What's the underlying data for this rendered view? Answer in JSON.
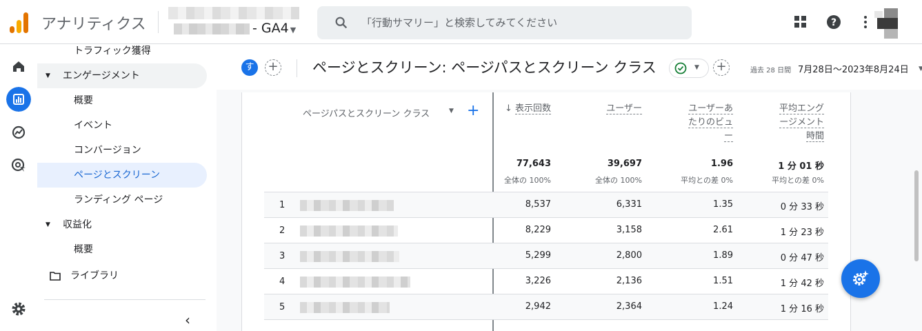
{
  "app": {
    "title": "アナリティクス",
    "property": "GA4"
  },
  "search": {
    "placeholder": "「行動サマリー」と検索してみてください"
  },
  "sidebar": {
    "items": [
      {
        "label": "トラフィック獲得"
      },
      {
        "label": "エンゲージメント"
      },
      {
        "label": "概要"
      },
      {
        "label": "イベント"
      },
      {
        "label": "コンバージョン"
      },
      {
        "label": "ページとスクリーン"
      },
      {
        "label": "ランディング ページ"
      },
      {
        "label": "収益化"
      },
      {
        "label": "概要"
      },
      {
        "label": "ライブラリ"
      }
    ]
  },
  "subheader": {
    "segment_chip": "す",
    "page_title": "ページとスクリーン: ページパスとスクリーン クラス",
    "date_label": "過去 28 日間",
    "date_range": "7月28日～2023年8月24日"
  },
  "table": {
    "dimension_header": "ページパスとスクリーン クラス",
    "metric_headers": [
      "表示回数",
      "ユーザー",
      "ユーザーあたりのビュー",
      "平均エンゲージメント時間"
    ],
    "metric_header_lines": [
      [
        "表示回数"
      ],
      [
        "ユーザー"
      ],
      [
        "ユーザーあ",
        "たりのビュ",
        "ー"
      ],
      [
        "平均エング",
        "ージメント",
        "時間"
      ]
    ],
    "totals": [
      "77,643",
      "39,697",
      "1.96",
      "1 分 01 秒"
    ],
    "totals_sub": [
      "全体の 100%",
      "全体の 100%",
      "平均との差 0%",
      "平均との差 0%"
    ],
    "rows": [
      {
        "index": "1",
        "views": "8,537",
        "users": "6,331",
        "views_per_user": "1.35",
        "avg_time": "0 分 33 秒"
      },
      {
        "index": "2",
        "views": "8,229",
        "users": "3,158",
        "views_per_user": "2.61",
        "avg_time": "1 分 23 秒"
      },
      {
        "index": "3",
        "views": "5,299",
        "users": "2,800",
        "views_per_user": "1.89",
        "avg_time": "0 分 47 秒"
      },
      {
        "index": "4",
        "views": "3,226",
        "users": "2,136",
        "views_per_user": "1.51",
        "avg_time": "1 分 42 秒"
      },
      {
        "index": "5",
        "views": "2,942",
        "users": "2,364",
        "views_per_user": "1.24",
        "avg_time": "1 分 16 秒"
      }
    ]
  },
  "colors": {
    "accent": "#1a73e8",
    "active_bg": "#e8f0fe",
    "logo_orange": "#f9ab00",
    "logo_dark": "#e37400"
  }
}
